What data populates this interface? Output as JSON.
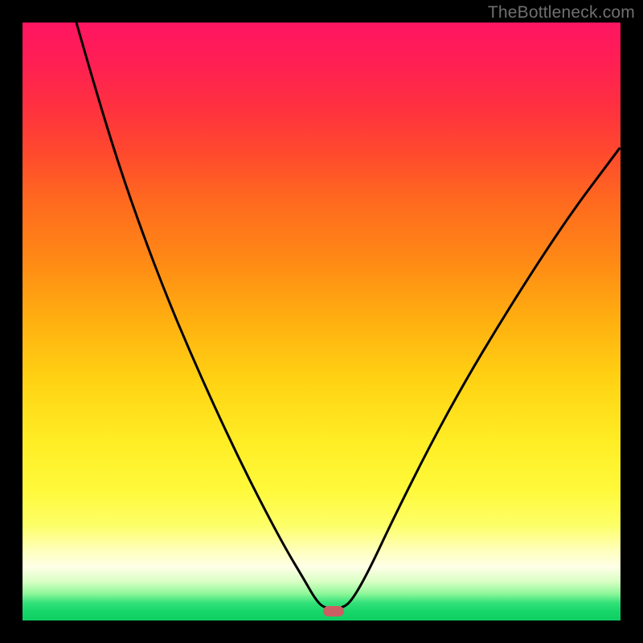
{
  "watermark": "TheBottleneck.com",
  "colors": {
    "curve_stroke": "#000000",
    "marker_fill": "#cb5e62",
    "frame_bg": "#000000"
  },
  "marker": {
    "x_frac": 0.5195,
    "y_frac": 0.984
  },
  "chart_data": {
    "type": "line",
    "title": "",
    "xlabel": "",
    "ylabel": "",
    "xlim": [
      0,
      1
    ],
    "ylim": [
      0,
      1
    ],
    "legend": false,
    "grid": false,
    "annotations": [
      "TheBottleneck.com"
    ],
    "series": [
      {
        "name": "bottleneck-curve",
        "note": "V-shaped curve; y is fraction from top (0=top, 1=bottom). Values estimated from pixels.",
        "x": [
          0.09,
          0.12,
          0.16,
          0.2,
          0.24,
          0.28,
          0.32,
          0.36,
          0.4,
          0.44,
          0.47,
          0.49,
          0.505,
          0.535,
          0.552,
          0.58,
          0.62,
          0.68,
          0.74,
          0.8,
          0.86,
          0.92,
          0.98,
          1.0
        ],
        "y": [
          0.0,
          0.105,
          0.235,
          0.35,
          0.455,
          0.55,
          0.64,
          0.725,
          0.805,
          0.88,
          0.93,
          0.965,
          0.98,
          0.98,
          0.965,
          0.915,
          0.83,
          0.71,
          0.6,
          0.5,
          0.405,
          0.315,
          0.235,
          0.208
        ]
      }
    ],
    "background_gradient": {
      "direction": "top-to-bottom",
      "stops": [
        {
          "pos": 0.0,
          "color": "#ff1562"
        },
        {
          "pos": 0.3,
          "color": "#ff6a1f"
        },
        {
          "pos": 0.6,
          "color": "#ffd313"
        },
        {
          "pos": 0.88,
          "color": "#feffb6"
        },
        {
          "pos": 0.955,
          "color": "#8ff79a"
        },
        {
          "pos": 1.0,
          "color": "#0fcf63"
        }
      ]
    },
    "marker": {
      "shape": "rounded-rect",
      "x_frac": 0.5195,
      "y_frac": 0.984,
      "color": "#cb5e62"
    }
  }
}
